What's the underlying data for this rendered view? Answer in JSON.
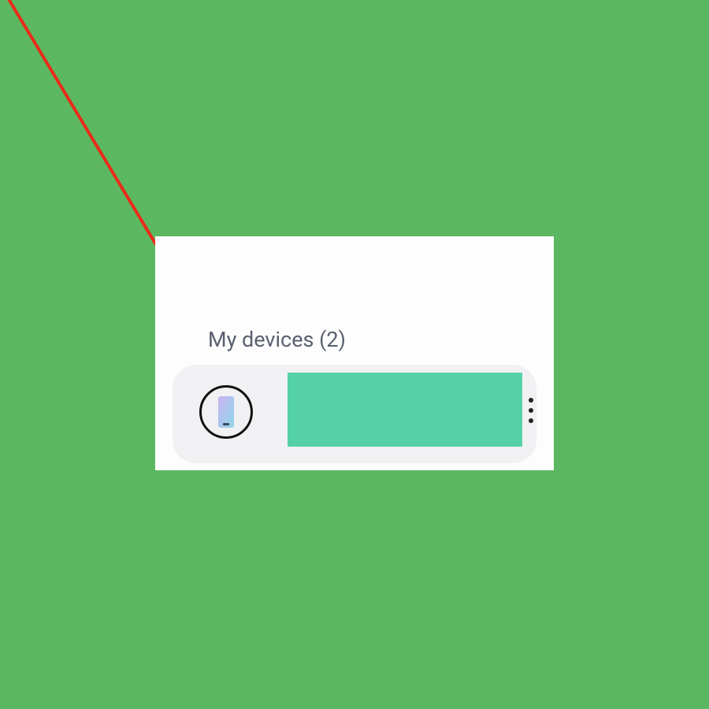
{
  "section": {
    "title": "My devices (2)"
  },
  "device": {
    "icon": "phone-icon"
  },
  "colors": {
    "background": "#5cb860",
    "redaction": "#55d1a8",
    "arrow": "#eb2a1a"
  }
}
